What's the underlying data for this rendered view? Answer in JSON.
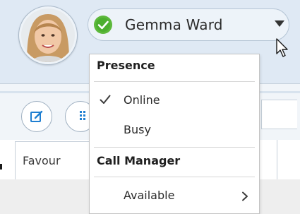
{
  "user": {
    "name": "Gemma Ward",
    "status": "Online",
    "status_color": "#4caf2f"
  },
  "toolbar": {
    "compose_icon": "compose-icon",
    "dialpad_icon": "dialpad-icon"
  },
  "tabs": [
    {
      "label": "Favour"
    }
  ],
  "presence_menu": {
    "presence_header": "Presence",
    "presence_items": [
      {
        "label": "Online",
        "checked": true
      },
      {
        "label": "Busy",
        "checked": false
      }
    ],
    "call_manager_header": "Call Manager",
    "call_manager_items": [
      {
        "label": "Available",
        "has_submenu": true
      }
    ]
  },
  "colors": {
    "header_bg": "#dfe9f4",
    "accent_blue": "#1f7fd1",
    "online_green": "#4caf2f"
  }
}
